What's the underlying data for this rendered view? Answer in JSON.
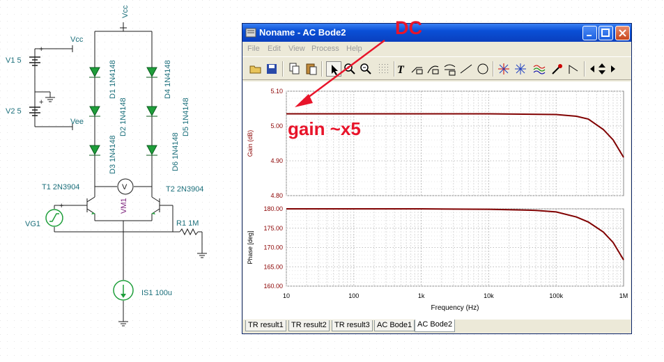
{
  "schematic": {
    "labels": {
      "vcc_top": "Vcc",
      "vcc_supply": "Vcc",
      "vee_supply": "Vee",
      "v1": "V1 5",
      "v2": "V2 5",
      "d1": "D1 1N4148",
      "d2": "D2 1N4148",
      "d3": "D3 1N4148",
      "d4": "D4 1N4148",
      "d5": "D5 1N4148",
      "d6": "D6 1N4148",
      "t1": "T1 2N3904",
      "t2": "T2 2N3904",
      "vm1": "VM1",
      "vg1": "VG1",
      "r1": "R1 1M",
      "is1": "IS1 100u",
      "plus1": "+",
      "plus2": "+",
      "plus3": "+",
      "voltmeter": "V"
    }
  },
  "window": {
    "title": "Noname - AC Bode2",
    "menu": [
      "File",
      "Edit",
      "View",
      "Process",
      "Help"
    ],
    "toolbar_icons": [
      "open-icon",
      "save-icon",
      "copy-icon",
      "paste-icon",
      "pointer-icon",
      "zoom-in-icon",
      "zoom-out-icon",
      "grid-icon",
      "text-icon",
      "label-icon",
      "curve-label-icon",
      "axis-label-icon",
      "line-icon",
      "circle-icon",
      "cursor-a-icon",
      "cursor-b-icon",
      "waves-icon",
      "eyedropper-icon",
      "step-icon",
      "arrow-left-icon",
      "arrow-updown-icon",
      "arrow-right-icon"
    ],
    "tabs": [
      "TR result1",
      "TR result2",
      "TR result3",
      "AC Bode1",
      "AC Bode2"
    ],
    "active_tab": "AC Bode2"
  },
  "chart_data": [
    {
      "type": "line",
      "xlabel": "",
      "ylabel": "Gain (dB)",
      "x_scale": "log",
      "xlim": [
        10,
        1000000
      ],
      "ylim": [
        4.8,
        5.1
      ],
      "y_ticks": [
        "5.10",
        "5.00",
        "4.90",
        "4.80"
      ],
      "grid": true,
      "color": "#800000",
      "x": [
        10,
        100,
        1000,
        10000,
        100000,
        200000,
        300000,
        500000,
        700000,
        1000000
      ],
      "y": [
        5.035,
        5.035,
        5.035,
        5.035,
        5.033,
        5.028,
        5.02,
        4.99,
        4.96,
        4.91
      ]
    },
    {
      "type": "line",
      "xlabel": "Frequency (Hz)",
      "ylabel": "Phase [deg]",
      "x_scale": "log",
      "xlim": [
        10,
        1000000
      ],
      "ylim": [
        160,
        180
      ],
      "y_ticks": [
        "180.00",
        "175.00",
        "170.00",
        "165.00",
        "160.00"
      ],
      "x_ticks": [
        "10",
        "100",
        "1k",
        "10k",
        "100k",
        "1M"
      ],
      "grid": true,
      "color": "#800000",
      "x": [
        10,
        100,
        1000,
        10000,
        50000,
        100000,
        200000,
        300000,
        500000,
        700000,
        1000000
      ],
      "y": [
        180,
        180,
        180,
        179.9,
        179.6,
        179.2,
        177.9,
        176.6,
        174,
        171.3,
        166.8
      ]
    }
  ],
  "annotations": {
    "dc": "DC",
    "gain": "gain ~x5",
    "color": "#e8142a"
  }
}
